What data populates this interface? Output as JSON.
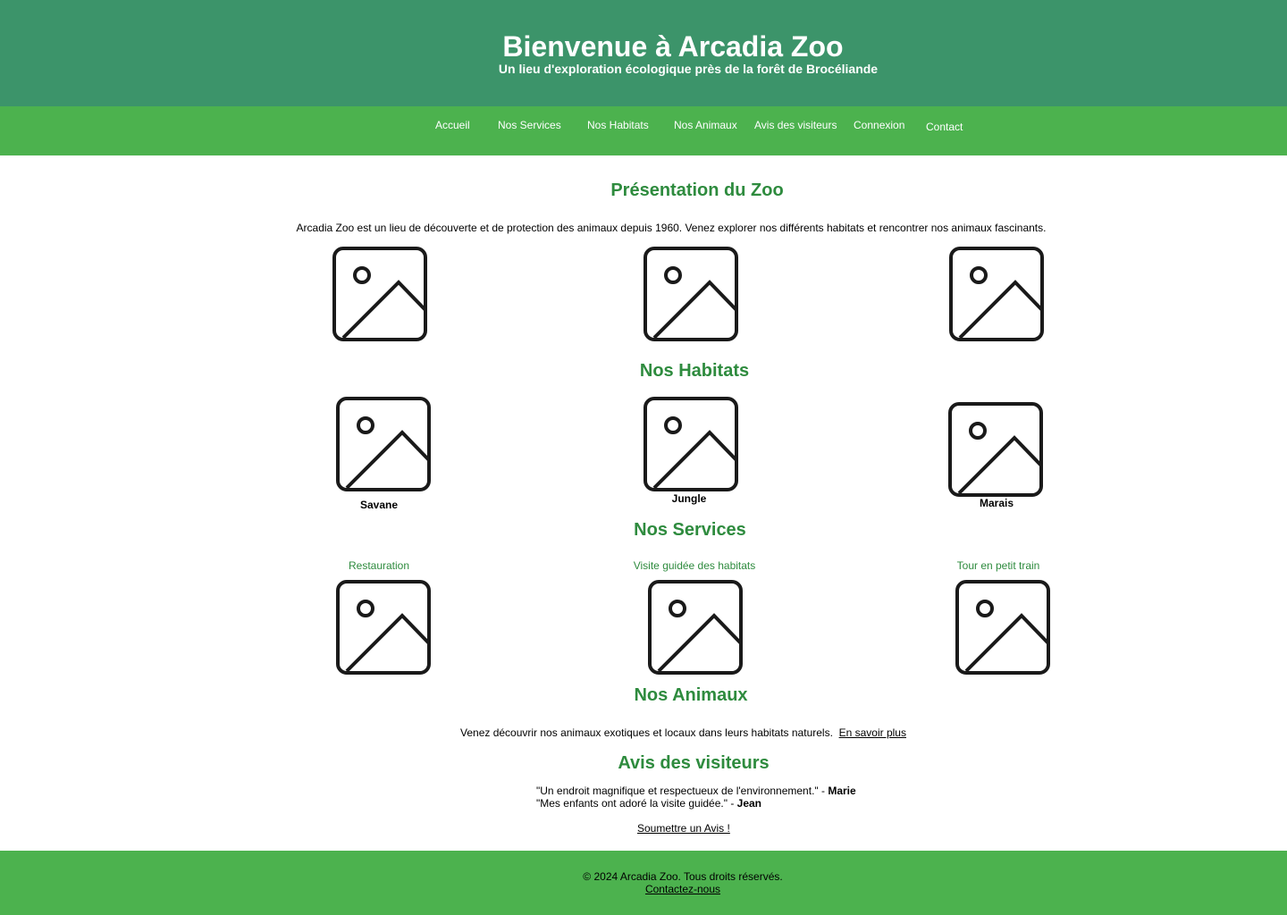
{
  "header": {
    "title": "Bienvenue à Arcadia Zoo",
    "subtitle": "Un lieu d'exploration écologique près de la forêt de Brocéliande"
  },
  "nav": {
    "items": [
      {
        "label": "Accueil"
      },
      {
        "label": "Nos Services"
      },
      {
        "label": "Nos Habitats"
      },
      {
        "label": "Nos Animaux"
      },
      {
        "label": "Avis des visiteurs"
      },
      {
        "label": "Connexion"
      },
      {
        "label": "Contact"
      }
    ]
  },
  "presentation": {
    "title": "Présentation du Zoo",
    "text": "Arcadia Zoo est un lieu de découverte et de protection des animaux depuis 1960. Venez explorer nos différents habitats et rencontrer nos animaux fascinants."
  },
  "habitats": {
    "title": "Nos Habitats",
    "items": [
      {
        "name": "Savane"
      },
      {
        "name": "Jungle"
      },
      {
        "name": "Marais"
      }
    ]
  },
  "services": {
    "title": "Nos Services",
    "items": [
      {
        "name": "Restauration"
      },
      {
        "name": "Visite guidée des habitats"
      },
      {
        "name": "Tour en petit train"
      }
    ]
  },
  "animals": {
    "title": "Nos Animaux",
    "text": "Venez découvrir nos animaux exotiques et locaux dans leurs habitats naturels.",
    "link": "En savoir plus"
  },
  "reviews": {
    "title": "Avis des visiteurs",
    "items": [
      {
        "quote": "\"Un endroit magnifique et respectueux de l'environnement.\" - ",
        "author": "Marie"
      },
      {
        "quote": "\"Mes enfants ont adoré la visite guidée.\" - ",
        "author": "Jean"
      }
    ],
    "submit_link": "Soumettre un Avis !"
  },
  "footer": {
    "copyright": "© 2024 Arcadia Zoo. Tous droits réservés.",
    "contact_link": "Contactez-nous"
  },
  "colors": {
    "header_bg": "#3c946a",
    "nav_bg": "#4cb24e",
    "footer_bg": "#4cb24e",
    "heading": "#2e8b3e"
  },
  "icons": {
    "image_placeholder": "image-placeholder-icon"
  }
}
